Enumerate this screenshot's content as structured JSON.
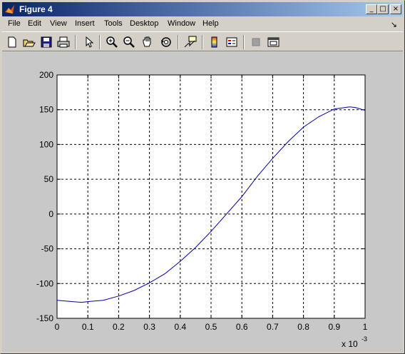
{
  "window": {
    "title": "Figure 4"
  },
  "menu": [
    "File",
    "Edit",
    "View",
    "Insert",
    "Tools",
    "Desktop",
    "Window",
    "Help"
  ],
  "menu_dock": "↘",
  "toolbar": [
    "new-icon",
    "open-icon",
    "save-icon",
    "print-icon",
    "pointer-icon",
    "zoom-in-icon",
    "zoom-out-icon",
    "pan-icon",
    "rotate-icon",
    "data-cursor-icon",
    "colorbar-icon",
    "legend-icon",
    "hide-plot-tools-icon",
    "show-plot-tools-icon"
  ],
  "colors": {
    "line": "#0000aa",
    "axes_bg": "#ffffff",
    "figure_bg": "#c8c8c8"
  },
  "chart_data": {
    "type": "line",
    "title": "",
    "xlabel": "",
    "ylabel": "",
    "x_multiplier_label": "x 10",
    "x_multiplier_exp": "-3",
    "xlim": [
      0,
      1
    ],
    "ylim": [
      -150,
      200
    ],
    "xticks": [
      "0",
      "0.1",
      "0.2",
      "0.3",
      "0.4",
      "0.5",
      "0.6",
      "0.7",
      "0.8",
      "0.9",
      "1"
    ],
    "yticks": [
      "200",
      "150",
      "100",
      "50",
      "0",
      "-50",
      "-100",
      "-150"
    ],
    "grid": true,
    "series": [
      {
        "x": [
          0,
          0.05,
          0.08,
          0.1,
          0.15,
          0.2,
          0.25,
          0.3,
          0.35,
          0.4,
          0.45,
          0.5,
          0.55,
          0.6,
          0.65,
          0.7,
          0.75,
          0.8,
          0.85,
          0.9,
          0.95,
          0.97,
          1.0
        ],
        "y": [
          -124,
          -126,
          -127,
          -126,
          -124,
          -118,
          -110,
          -99,
          -86,
          -68,
          -48,
          -25,
          0,
          25,
          54,
          80,
          104,
          125,
          140,
          151,
          154,
          153,
          149
        ]
      }
    ]
  }
}
